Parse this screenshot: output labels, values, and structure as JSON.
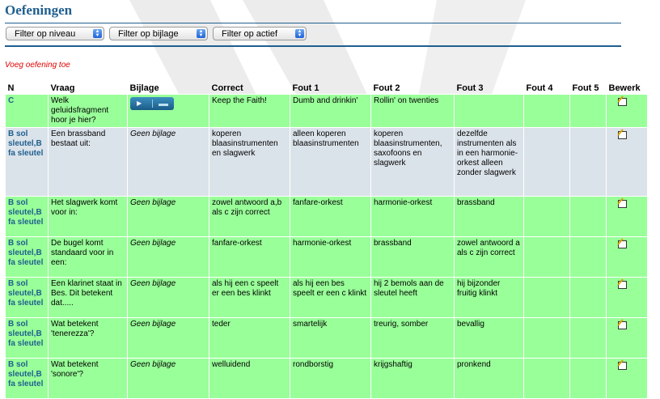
{
  "page": {
    "title": "Oefeningen"
  },
  "filters": [
    {
      "label": "Filter op niveau"
    },
    {
      "label": "Filter op bijlage"
    },
    {
      "label": "Filter op actief"
    }
  ],
  "add_link": "Voeg oefening toe",
  "table": {
    "headers": [
      "N",
      "Vraag",
      "Bijlage",
      "Correct",
      "Fout 1",
      "Fout 2",
      "Fout 3",
      "Fout 4",
      "Fout 5",
      "Bewerk"
    ],
    "rows": [
      {
        "n": "C",
        "vraag": "Welk geluidsfragment hoor je hier?",
        "bijlage": "",
        "correct": "Keep the Faith!",
        "fout1": "Dumb and drinkin'",
        "fout2": "Rollin' on twenties",
        "fout3": "",
        "fout4": "",
        "fout5": ""
      },
      {
        "n": "B sol sleutel,B fa sleutel",
        "vraag": "Een brassband bestaat uit:",
        "bijlage": "Geen bijlage",
        "correct": "koperen blaasinstrumenten en slagwerk",
        "fout1": "alleen koperen blaasinstrumenten",
        "fout2": "koperen blaasinstrumenten, saxofoons en slagwerk",
        "fout3": "dezelfde instrumenten als in een harmonie-orkest alleen zonder slagwerk",
        "fout4": "",
        "fout5": ""
      },
      {
        "n": "B sol sleutel,B fa sleutel",
        "vraag": "Het slagwerk komt voor in:",
        "bijlage": "Geen bijlage",
        "correct": "zowel antwoord a,b als c zijn correct",
        "fout1": "fanfare-orkest",
        "fout2": "harmonie-orkest",
        "fout3": "brassband",
        "fout4": "",
        "fout5": ""
      },
      {
        "n": "B sol sleutel,B fa sleutel",
        "vraag": "De bugel komt standaard voor in een:",
        "bijlage": "Geen bijlage",
        "correct": "fanfare-orkest",
        "fout1": "harmonie-orkest",
        "fout2": "brassband",
        "fout3": "zowel antwoord a als c zijn correct",
        "fout4": "",
        "fout5": ""
      },
      {
        "n": "B sol sleutel,B fa sleutel",
        "vraag": "Een klarinet staat in Bes. Dit betekent dat.....",
        "bijlage": "Geen bijlage",
        "correct": "als hij een c speelt er een bes klinkt",
        "fout1": "als hij een bes speelt er een c klinkt",
        "fout2": "hij 2 bemols aan de sleutel heeft",
        "fout3": "hij bijzonder fruitig klinkt",
        "fout4": "",
        "fout5": ""
      },
      {
        "n": "B sol sleutel,B fa sleutel",
        "vraag": "Wat betekent 'tenerezza'?",
        "bijlage": "Geen bijlage",
        "correct": "teder",
        "fout1": "smartelijk",
        "fout2": "treurig, somber",
        "fout3": "bevallig",
        "fout4": "",
        "fout5": ""
      },
      {
        "n": "B sol sleutel,B fa sleutel",
        "vraag": "Wat betekent 'sonore'?",
        "bijlage": "Geen bijlage",
        "correct": "welluidend",
        "fout1": "rondborstig",
        "fout2": "krijgshaftig",
        "fout3": "pronkend",
        "fout4": "",
        "fout5": ""
      }
    ]
  },
  "icons": {
    "edit": "edit-icon",
    "play": "play-icon",
    "select_arrow": "updown-arrow-icon"
  },
  "colors": {
    "title": "#1f5f8f",
    "row_green": "#99ff99",
    "row_grey": "#dbe3ea",
    "link_red": "#e10000"
  }
}
